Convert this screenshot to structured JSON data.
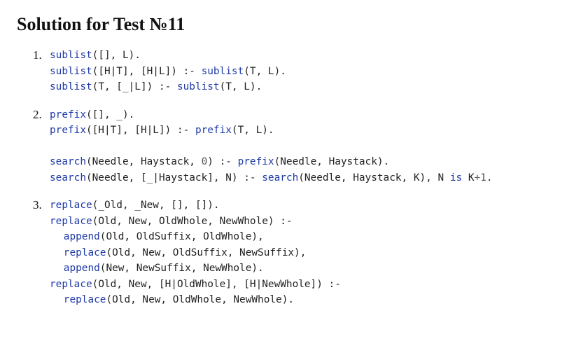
{
  "title": "Solution for Test №11",
  "solutions": [
    {
      "number": "1.",
      "lines": [
        [
          [
            "pred",
            "sublist"
          ],
          [
            "txt",
            "([], L)."
          ]
        ],
        [
          [
            "pred",
            "sublist"
          ],
          [
            "txt",
            "([H|T], [H|L]) :- "
          ],
          [
            "pred",
            "sublist"
          ],
          [
            "txt",
            "(T, L)."
          ]
        ],
        [
          [
            "pred",
            "sublist"
          ],
          [
            "txt",
            "(T, [_|L]) :- "
          ],
          [
            "pred",
            "sublist"
          ],
          [
            "txt",
            "(T, L)."
          ]
        ]
      ]
    },
    {
      "number": "2.",
      "lines": [
        [
          [
            "pred",
            "prefix"
          ],
          [
            "txt",
            "([], _)."
          ]
        ],
        [
          [
            "pred",
            "prefix"
          ],
          [
            "txt",
            "([H|T], [H|L]) :- "
          ],
          [
            "pred",
            "prefix"
          ],
          [
            "txt",
            "(T, L)."
          ]
        ],
        [],
        [
          [
            "pred",
            "search"
          ],
          [
            "txt",
            "(Needle, Haystack, "
          ],
          [
            "num",
            "0"
          ],
          [
            "txt",
            ") :- "
          ],
          [
            "pred",
            "prefix"
          ],
          [
            "txt",
            "(Needle, Haystack)."
          ]
        ],
        [
          [
            "pred",
            "search"
          ],
          [
            "txt",
            "(Needle, [_|Haystack], N) :- "
          ],
          [
            "pred",
            "search"
          ],
          [
            "txt",
            "(Needle, Haystack, K), N "
          ],
          [
            "kw",
            "is"
          ],
          [
            "txt",
            " K"
          ],
          [
            "num",
            "+1"
          ],
          [
            "txt",
            "."
          ]
        ]
      ]
    },
    {
      "number": "3.",
      "lines": [
        [
          [
            "pred",
            "replace"
          ],
          [
            "txt",
            "(_Old, _New, [], [])."
          ]
        ],
        [
          [
            "pred",
            "replace"
          ],
          [
            "txt",
            "(Old, New, OldWhole, NewWhole) :-"
          ]
        ],
        [
          [
            "ind",
            ""
          ],
          [
            "pred",
            "append"
          ],
          [
            "txt",
            "(Old, OldSuffix, OldWhole),"
          ]
        ],
        [
          [
            "ind",
            ""
          ],
          [
            "pred",
            "replace"
          ],
          [
            "txt",
            "(Old, New, OldSuffix, NewSuffix),"
          ]
        ],
        [
          [
            "ind",
            ""
          ],
          [
            "pred",
            "append"
          ],
          [
            "txt",
            "(New, NewSuffix, NewWhole)."
          ]
        ],
        [
          [
            "pred",
            "replace"
          ],
          [
            "txt",
            "(Old, New, [H|OldWhole], [H|NewWhole]) :-"
          ]
        ],
        [
          [
            "ind",
            ""
          ],
          [
            "pred",
            "replace"
          ],
          [
            "txt",
            "(Old, New, OldWhole, NewWhole)."
          ]
        ]
      ]
    }
  ]
}
